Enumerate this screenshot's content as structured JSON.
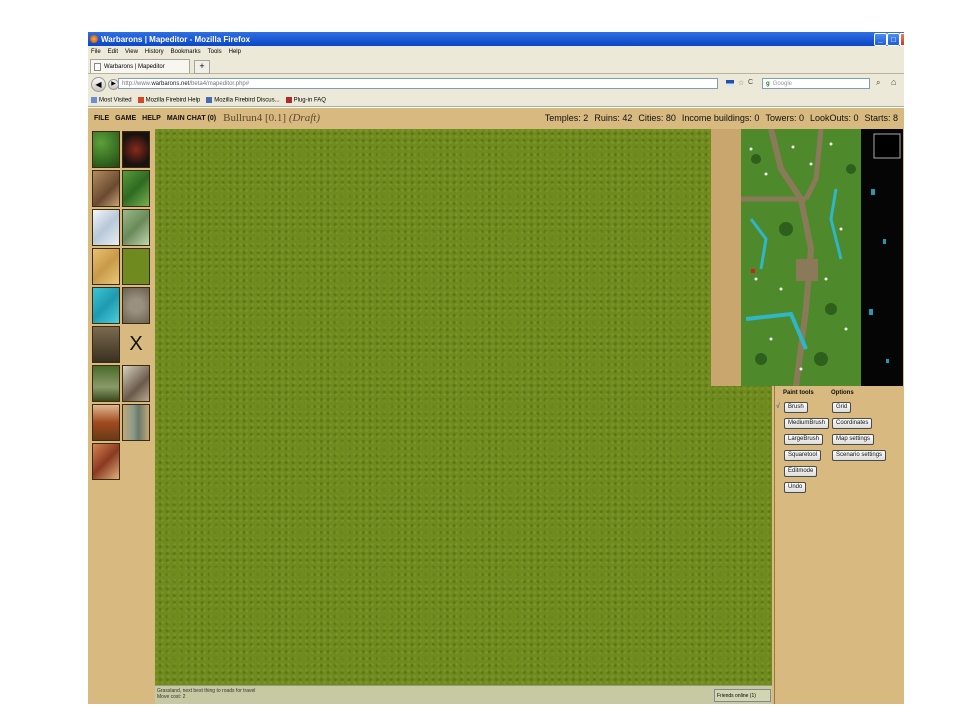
{
  "window": {
    "title": "Warbarons | Mapeditor - Mozilla Firefox",
    "controls": {
      "minimize": "_",
      "maximize": "□",
      "close": "X"
    }
  },
  "menubar": [
    "File",
    "Edit",
    "View",
    "History",
    "Bookmarks",
    "Tools",
    "Help"
  ],
  "tab": {
    "label": "Warbarons | Mapeditor",
    "new_tab": "+"
  },
  "nav": {
    "back": "◀",
    "forward": "▶",
    "url_prefix": "http://www.",
    "url_host": "warbarons.net",
    "url_path": "/beta4/mapeditor.php#",
    "search_placeholder": "Google"
  },
  "bookmarks": [
    "Most Visited",
    "Mozilla Firebird Help",
    "Mozilla Firebird Discus...",
    "Plug-in FAQ"
  ],
  "app": {
    "menu": [
      "FILE",
      "GAME",
      "HELP",
      "MAIN CHAT (0)"
    ],
    "map_name": "Bullrun4 [0.1]",
    "map_state": "(Draft)",
    "stats": {
      "temples": "Temples: 2",
      "ruins": "Ruins: 42",
      "cities": "Cities: 80",
      "income": "Income buildings: 0",
      "towers": "Towers: 0",
      "lookouts": "LookOuts: 0",
      "starts": "Starts: 8"
    },
    "palette_delete_symbol": "X",
    "status_line1": "Grassland, next best thing to roads for travel",
    "status_line2": "Move cost: 2",
    "friends_online": "Friends online (1)",
    "paint_tools_title": "Paint tools",
    "options_title": "Options",
    "paint_tools": [
      "Brush",
      "MediumBrush",
      "LargeBrush",
      "Squaretool",
      "Editmode",
      "Undo"
    ],
    "options": [
      "Grid",
      "Coordinates",
      "Map settings",
      "Scenario settings"
    ],
    "selected_tool_marker": "√"
  },
  "colors": {
    "grass": "#6f8a1f",
    "sand_panel": "#dcbd86",
    "water": "#2fb6c8",
    "titlebar": "#0a46c8"
  },
  "icons": {
    "palette": [
      "forest-tile",
      "volcano-tile",
      "hills-tile",
      "swamp-tile",
      "snow-tile",
      "marsh-tile",
      "desert-tile",
      "grass-tile",
      "water-tile",
      "road-tile",
      "bridge-tile",
      "delete-icon",
      "ruin-tile",
      "temple-tile",
      "hero-tile",
      "tower-tile",
      "city-tile"
    ]
  }
}
